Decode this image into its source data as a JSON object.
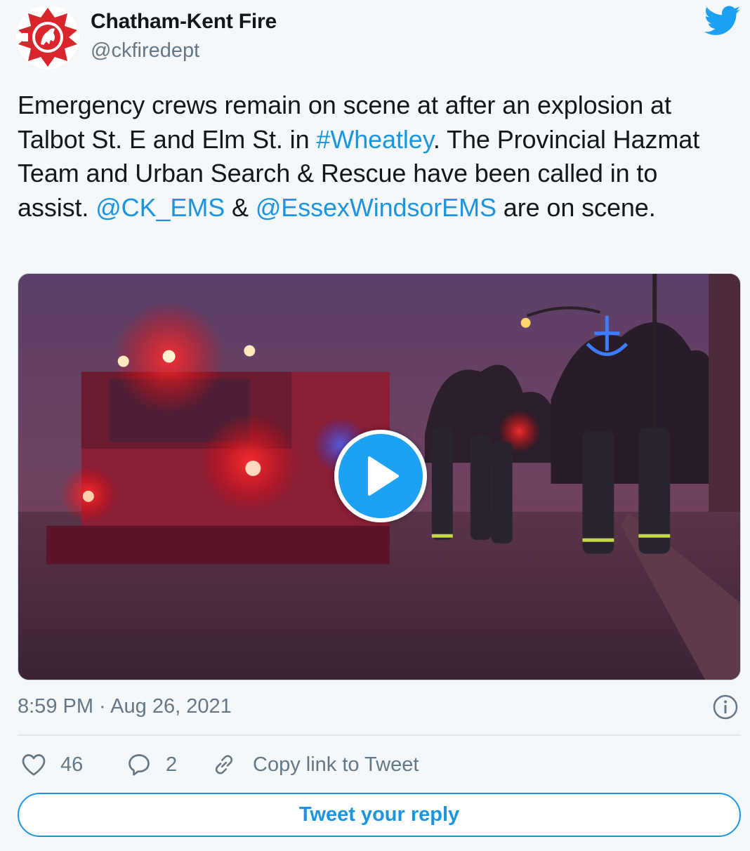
{
  "author": {
    "display_name": "Chatham-Kent Fire",
    "handle": "@ckfiredept",
    "avatar_icon": "fire-department-maltese-cross-icon"
  },
  "platform_icon": "twitter-bird-icon",
  "tweet": {
    "text_1": "Emergency crews remain on scene at after an explosion at Talbot St. E and Elm St. in ",
    "hashtag": "#Wheatley",
    "text_2": ". The Provincial Hazmat Team and Urban Search & Rescue have been called in to assist.  ",
    "mention_1": "@CK_EMS",
    "text_3": " & ",
    "mention_2": "@EssexWindsorEMS",
    "text_4": " are on scene."
  },
  "media": {
    "type": "video",
    "play_icon": "play-icon"
  },
  "meta": {
    "timestamp": "8:59 PM · Aug 26, 2021",
    "info_icon": "info-icon"
  },
  "actions": {
    "like_count": "46",
    "reply_count": "2",
    "copy_link_label": "Copy link to Tweet"
  },
  "reply_button_label": "Tweet your reply",
  "colors": {
    "link": "#1b95e0",
    "brand": "#1da1f2",
    "muted": "#657786",
    "background": "#f5f8fa"
  }
}
